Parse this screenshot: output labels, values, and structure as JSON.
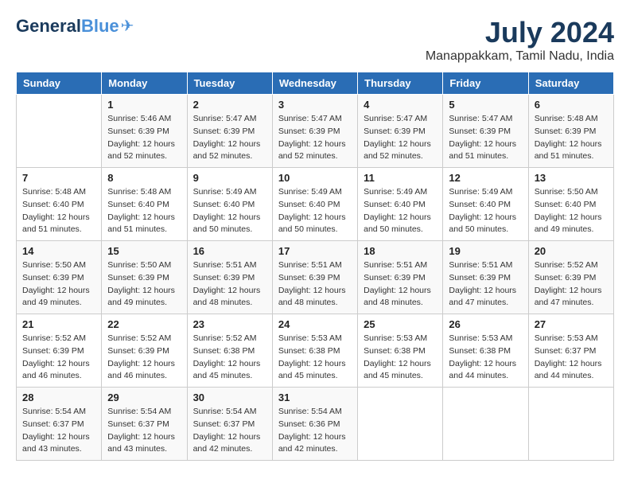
{
  "logo": {
    "general": "General",
    "blue": "Blue"
  },
  "title": "July 2024",
  "location": "Manappakkam, Tamil Nadu, India",
  "days_header": [
    "Sunday",
    "Monday",
    "Tuesday",
    "Wednesday",
    "Thursday",
    "Friday",
    "Saturday"
  ],
  "weeks": [
    [
      {
        "day": "",
        "sunrise": "",
        "sunset": "",
        "daylight": ""
      },
      {
        "day": "1",
        "sunrise": "Sunrise: 5:46 AM",
        "sunset": "Sunset: 6:39 PM",
        "daylight": "Daylight: 12 hours and 52 minutes."
      },
      {
        "day": "2",
        "sunrise": "Sunrise: 5:47 AM",
        "sunset": "Sunset: 6:39 PM",
        "daylight": "Daylight: 12 hours and 52 minutes."
      },
      {
        "day": "3",
        "sunrise": "Sunrise: 5:47 AM",
        "sunset": "Sunset: 6:39 PM",
        "daylight": "Daylight: 12 hours and 52 minutes."
      },
      {
        "day": "4",
        "sunrise": "Sunrise: 5:47 AM",
        "sunset": "Sunset: 6:39 PM",
        "daylight": "Daylight: 12 hours and 52 minutes."
      },
      {
        "day": "5",
        "sunrise": "Sunrise: 5:47 AM",
        "sunset": "Sunset: 6:39 PM",
        "daylight": "Daylight: 12 hours and 51 minutes."
      },
      {
        "day": "6",
        "sunrise": "Sunrise: 5:48 AM",
        "sunset": "Sunset: 6:39 PM",
        "daylight": "Daylight: 12 hours and 51 minutes."
      }
    ],
    [
      {
        "day": "7",
        "sunrise": "Sunrise: 5:48 AM",
        "sunset": "Sunset: 6:40 PM",
        "daylight": "Daylight: 12 hours and 51 minutes."
      },
      {
        "day": "8",
        "sunrise": "Sunrise: 5:48 AM",
        "sunset": "Sunset: 6:40 PM",
        "daylight": "Daylight: 12 hours and 51 minutes."
      },
      {
        "day": "9",
        "sunrise": "Sunrise: 5:49 AM",
        "sunset": "Sunset: 6:40 PM",
        "daylight": "Daylight: 12 hours and 50 minutes."
      },
      {
        "day": "10",
        "sunrise": "Sunrise: 5:49 AM",
        "sunset": "Sunset: 6:40 PM",
        "daylight": "Daylight: 12 hours and 50 minutes."
      },
      {
        "day": "11",
        "sunrise": "Sunrise: 5:49 AM",
        "sunset": "Sunset: 6:40 PM",
        "daylight": "Daylight: 12 hours and 50 minutes."
      },
      {
        "day": "12",
        "sunrise": "Sunrise: 5:49 AM",
        "sunset": "Sunset: 6:40 PM",
        "daylight": "Daylight: 12 hours and 50 minutes."
      },
      {
        "day": "13",
        "sunrise": "Sunrise: 5:50 AM",
        "sunset": "Sunset: 6:40 PM",
        "daylight": "Daylight: 12 hours and 49 minutes."
      }
    ],
    [
      {
        "day": "14",
        "sunrise": "Sunrise: 5:50 AM",
        "sunset": "Sunset: 6:39 PM",
        "daylight": "Daylight: 12 hours and 49 minutes."
      },
      {
        "day": "15",
        "sunrise": "Sunrise: 5:50 AM",
        "sunset": "Sunset: 6:39 PM",
        "daylight": "Daylight: 12 hours and 49 minutes."
      },
      {
        "day": "16",
        "sunrise": "Sunrise: 5:51 AM",
        "sunset": "Sunset: 6:39 PM",
        "daylight": "Daylight: 12 hours and 48 minutes."
      },
      {
        "day": "17",
        "sunrise": "Sunrise: 5:51 AM",
        "sunset": "Sunset: 6:39 PM",
        "daylight": "Daylight: 12 hours and 48 minutes."
      },
      {
        "day": "18",
        "sunrise": "Sunrise: 5:51 AM",
        "sunset": "Sunset: 6:39 PM",
        "daylight": "Daylight: 12 hours and 48 minutes."
      },
      {
        "day": "19",
        "sunrise": "Sunrise: 5:51 AM",
        "sunset": "Sunset: 6:39 PM",
        "daylight": "Daylight: 12 hours and 47 minutes."
      },
      {
        "day": "20",
        "sunrise": "Sunrise: 5:52 AM",
        "sunset": "Sunset: 6:39 PM",
        "daylight": "Daylight: 12 hours and 47 minutes."
      }
    ],
    [
      {
        "day": "21",
        "sunrise": "Sunrise: 5:52 AM",
        "sunset": "Sunset: 6:39 PM",
        "daylight": "Daylight: 12 hours and 46 minutes."
      },
      {
        "day": "22",
        "sunrise": "Sunrise: 5:52 AM",
        "sunset": "Sunset: 6:39 PM",
        "daylight": "Daylight: 12 hours and 46 minutes."
      },
      {
        "day": "23",
        "sunrise": "Sunrise: 5:52 AM",
        "sunset": "Sunset: 6:38 PM",
        "daylight": "Daylight: 12 hours and 45 minutes."
      },
      {
        "day": "24",
        "sunrise": "Sunrise: 5:53 AM",
        "sunset": "Sunset: 6:38 PM",
        "daylight": "Daylight: 12 hours and 45 minutes."
      },
      {
        "day": "25",
        "sunrise": "Sunrise: 5:53 AM",
        "sunset": "Sunset: 6:38 PM",
        "daylight": "Daylight: 12 hours and 45 minutes."
      },
      {
        "day": "26",
        "sunrise": "Sunrise: 5:53 AM",
        "sunset": "Sunset: 6:38 PM",
        "daylight": "Daylight: 12 hours and 44 minutes."
      },
      {
        "day": "27",
        "sunrise": "Sunrise: 5:53 AM",
        "sunset": "Sunset: 6:37 PM",
        "daylight": "Daylight: 12 hours and 44 minutes."
      }
    ],
    [
      {
        "day": "28",
        "sunrise": "Sunrise: 5:54 AM",
        "sunset": "Sunset: 6:37 PM",
        "daylight": "Daylight: 12 hours and 43 minutes."
      },
      {
        "day": "29",
        "sunrise": "Sunrise: 5:54 AM",
        "sunset": "Sunset: 6:37 PM",
        "daylight": "Daylight: 12 hours and 43 minutes."
      },
      {
        "day": "30",
        "sunrise": "Sunrise: 5:54 AM",
        "sunset": "Sunset: 6:37 PM",
        "daylight": "Daylight: 12 hours and 42 minutes."
      },
      {
        "day": "31",
        "sunrise": "Sunrise: 5:54 AM",
        "sunset": "Sunset: 6:36 PM",
        "daylight": "Daylight: 12 hours and 42 minutes."
      },
      {
        "day": "",
        "sunrise": "",
        "sunset": "",
        "daylight": ""
      },
      {
        "day": "",
        "sunrise": "",
        "sunset": "",
        "daylight": ""
      },
      {
        "day": "",
        "sunrise": "",
        "sunset": "",
        "daylight": ""
      }
    ]
  ]
}
